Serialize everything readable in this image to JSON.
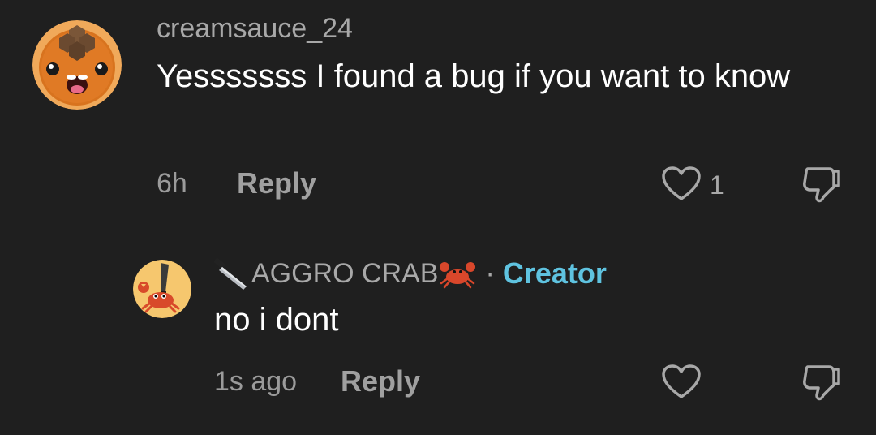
{
  "comment": {
    "username": "creamsauce_24",
    "text": "Yesssssss I found a bug if you want to know",
    "time": "6h",
    "reply_label": "Reply",
    "like_count": "1",
    "avatar_icon": "cat-face-avatar",
    "like_icon": "heart-icon",
    "dislike_icon": "thumbs-down-icon"
  },
  "reply": {
    "username": "AGGRO CRAB",
    "username_prefix_icon": "knife-emoji",
    "username_suffix_icon": "crab-emoji",
    "separator": "·",
    "creator_badge": "Creator",
    "text": "no i dont",
    "time": "1s ago",
    "reply_label": "Reply",
    "avatar_icon": "crab-with-knife-avatar",
    "like_icon": "heart-icon",
    "dislike_icon": "thumbs-down-icon"
  },
  "colors": {
    "background": "#1f1f1f",
    "creator_badge": "#5fc3e0",
    "secondary_text": "#a8a8a8"
  }
}
